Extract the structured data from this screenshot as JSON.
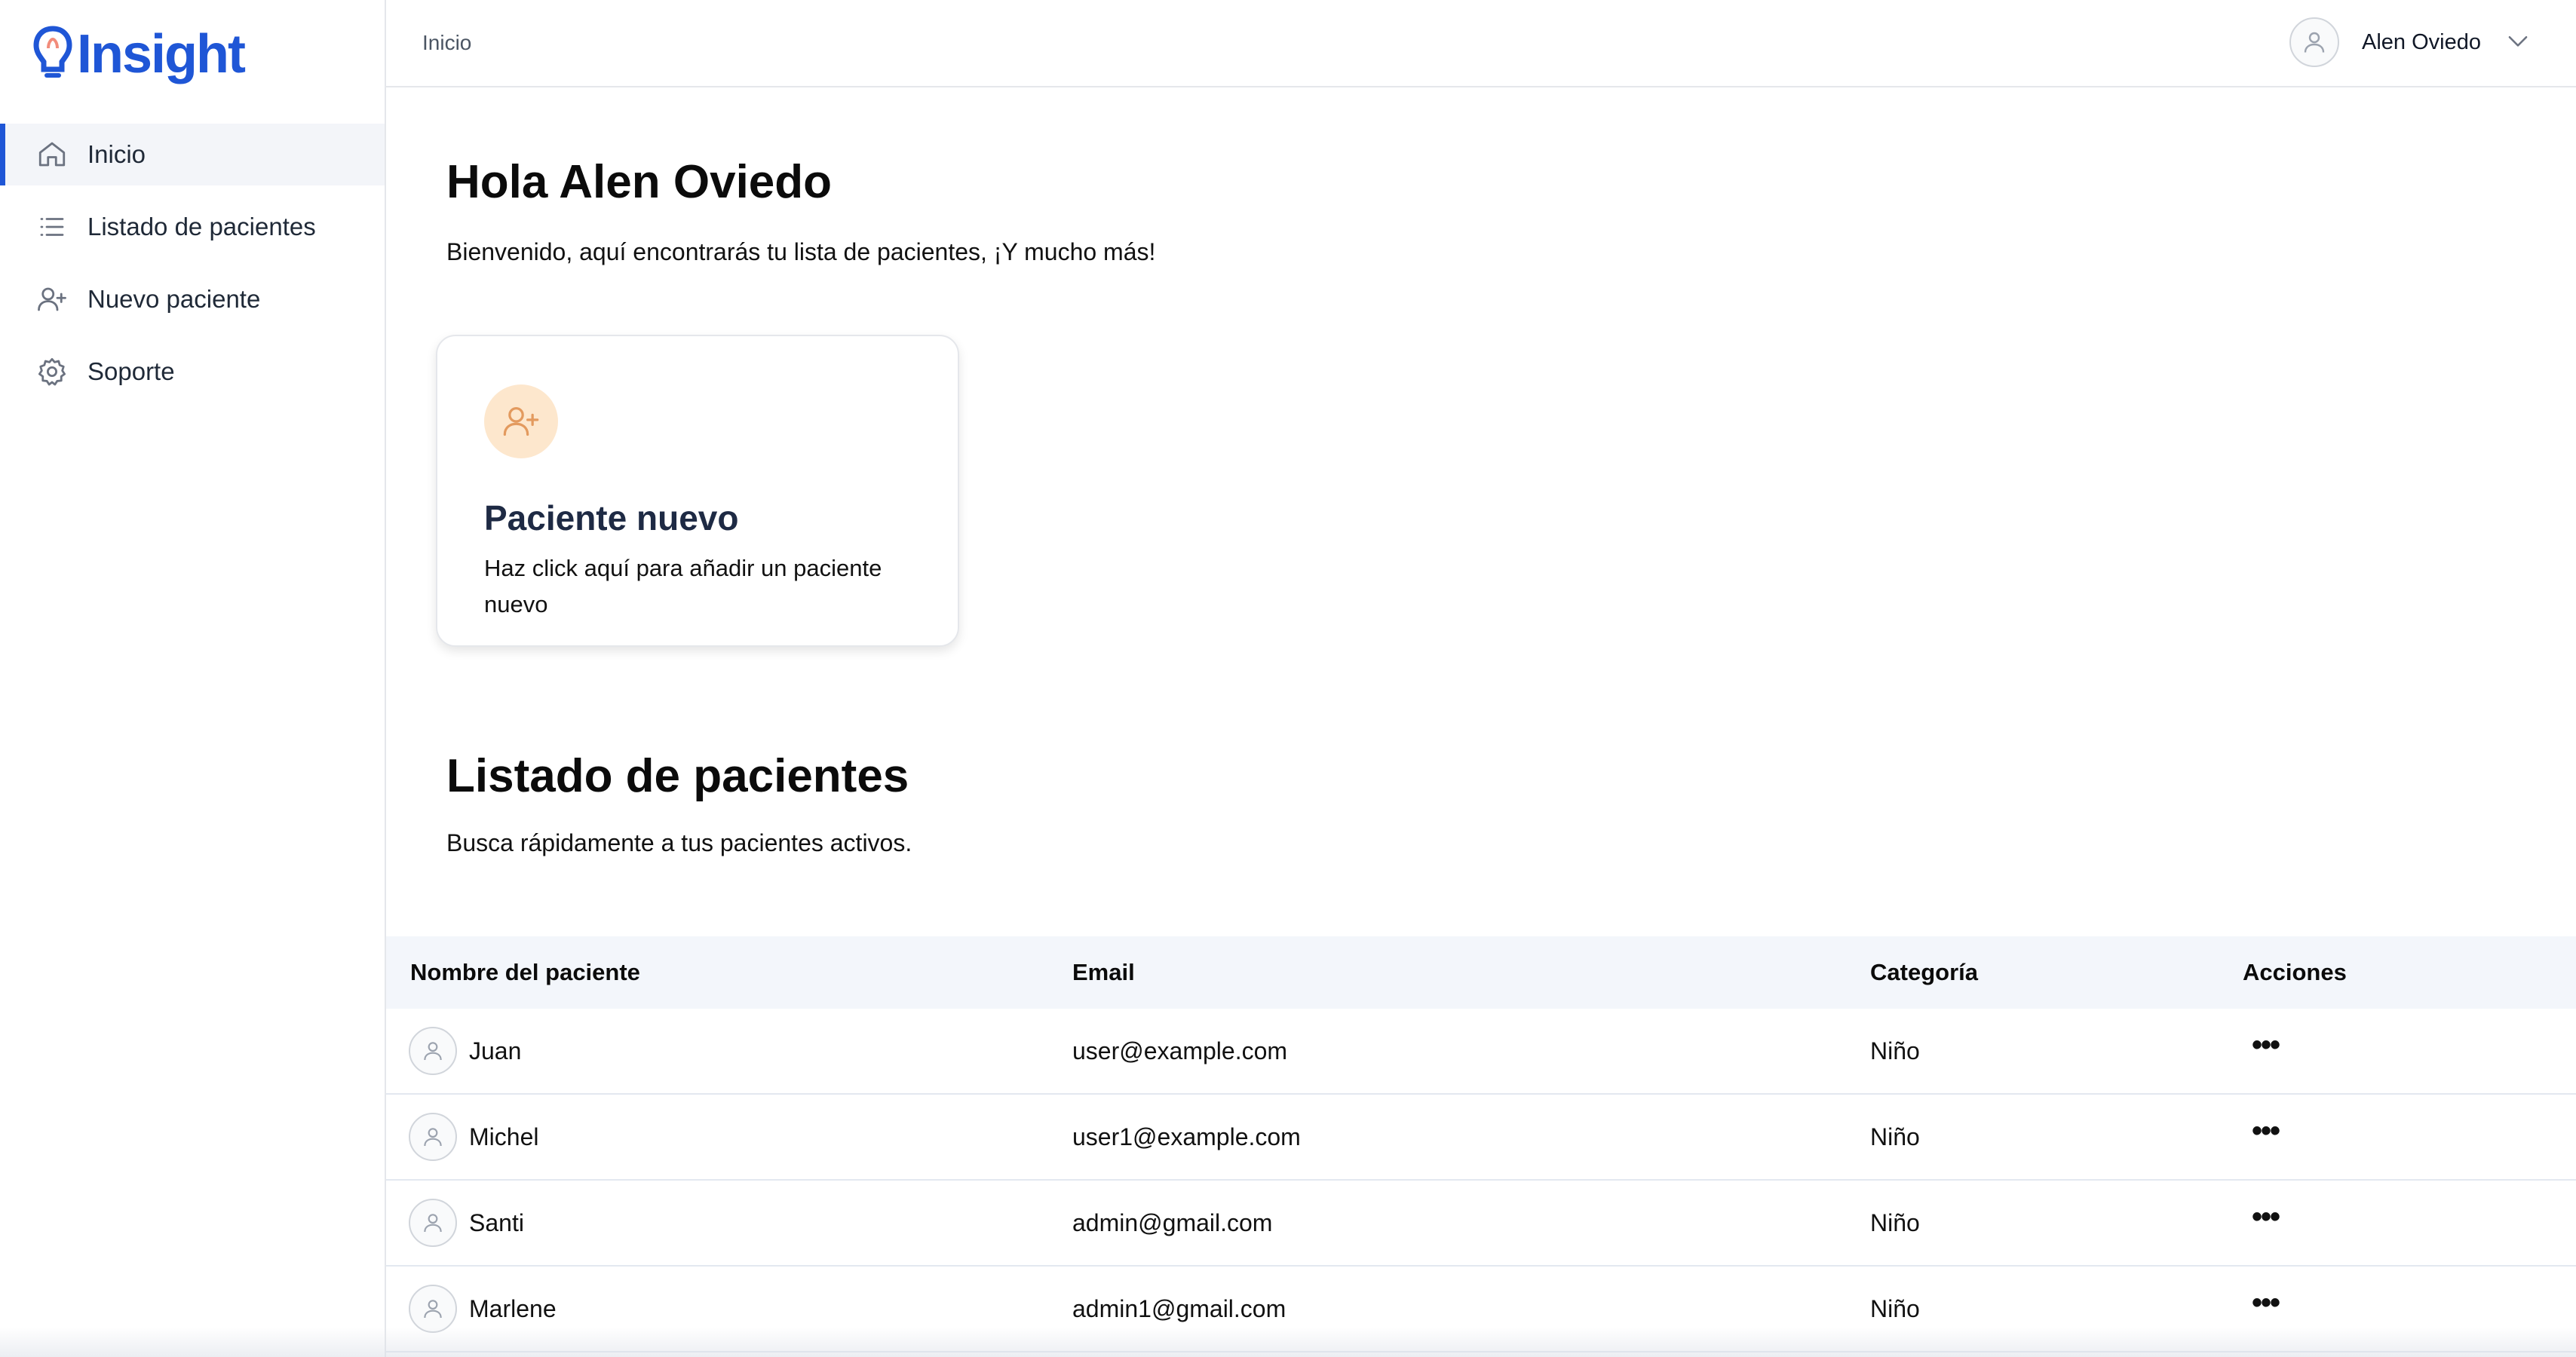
{
  "brand": {
    "name": "Insight",
    "color": "#1f56d6"
  },
  "sidebar": {
    "items": [
      {
        "label": "Inicio",
        "icon": "home-icon",
        "active": true
      },
      {
        "label": "Listado de pacientes",
        "icon": "list-icon",
        "active": false
      },
      {
        "label": "Nuevo paciente",
        "icon": "user-plus-icon",
        "active": false
      },
      {
        "label": "Soporte",
        "icon": "gear-icon",
        "active": false
      }
    ]
  },
  "topbar": {
    "breadcrumb": "Inicio",
    "user_name": "Alen Oviedo"
  },
  "welcome": {
    "title": "Hola Alen Oviedo",
    "subtitle": "Bienvenido, aquí encontrarás tu lista de pacientes, ¡Y mucho más!"
  },
  "new_patient_card": {
    "title": "Paciente nuevo",
    "description": "Haz click aquí para añadir un paciente nuevo",
    "icon": "user-plus-icon"
  },
  "patients": {
    "title": "Listado de pacientes",
    "subtitle": "Busca rápidamente a tus pacientes activos.",
    "columns": [
      "Nombre del paciente",
      "Email",
      "Categoría",
      "Acciones"
    ],
    "rows": [
      {
        "name": "Juan",
        "email": "user@example.com",
        "category": "Niño",
        "actions": "•••"
      },
      {
        "name": "Michel",
        "email": "user1@example.com",
        "category": "Niño",
        "actions": "•••"
      },
      {
        "name": "Santi",
        "email": "admin@gmail.com",
        "category": "Niño",
        "actions": "•••"
      },
      {
        "name": "Marlene",
        "email": "admin1@gmail.com",
        "category": "Niño",
        "actions": "•••"
      }
    ]
  }
}
